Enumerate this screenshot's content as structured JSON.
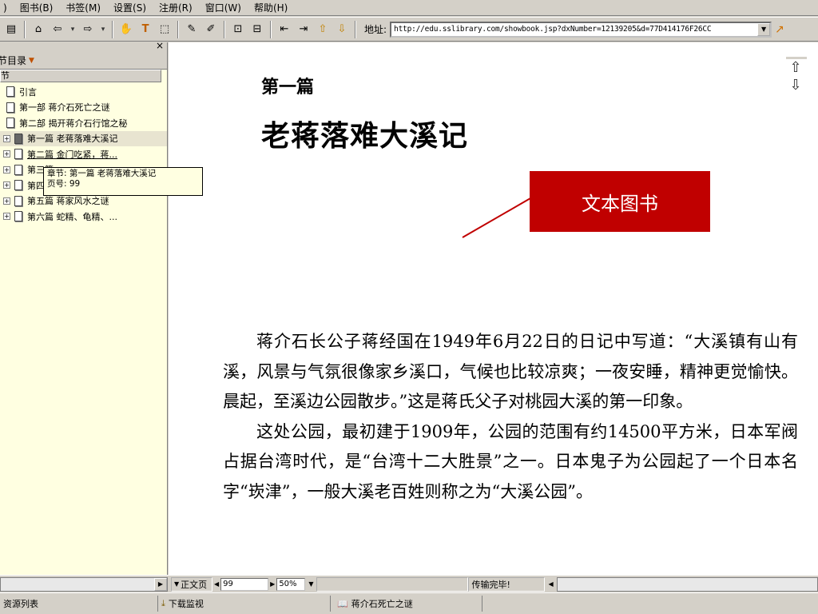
{
  "menubar": {
    "items": [
      ")",
      "图书(B)",
      "书签(M)",
      "设置(S)",
      "注册(R)",
      "窗口(W)",
      "帮助(H)"
    ]
  },
  "toolbar": {
    "address_label": "地址:",
    "address_value": "http://edu.sslibrary.com/showbook.jsp?dxNumber=12139205&d=77D414176F26CC"
  },
  "sidebar": {
    "close": "×",
    "title": "节目录",
    "column_header": "节",
    "items": [
      {
        "label": "引言",
        "expand": ""
      },
      {
        "label": "第一部 蒋介石死亡之谜",
        "expand": ""
      },
      {
        "label": "第二部 揭开蒋介石行馆之秘",
        "expand": ""
      },
      {
        "label": "第一篇 老蒋落难大溪记",
        "expand": "+"
      },
      {
        "label": "第二篇 金门吃紧，蒋...",
        "expand": "+"
      },
      {
        "label": "第三篇 ...",
        "expand": "+"
      },
      {
        "label": "第四篇 ...",
        "expand": "+"
      },
      {
        "label": "第五篇 蒋家风水之谜",
        "expand": "+"
      },
      {
        "label": "第六篇 蛇精、龟精、...",
        "expand": "+"
      }
    ],
    "tooltip": {
      "line1": "章节: 第一篇  老蒋落难大溪记",
      "line2": "页号: 99"
    }
  },
  "content": {
    "part_label": "第一篇",
    "chapter_title": "老蒋落难大溪记",
    "stamp": "文本图书",
    "paragraphs": [
      "蒋介石长公子蒋经国在1949年6月22日的日记中写道：“大溪镇有山有溪，风景与气氛很像家乡溪口，气候也比较凉爽；一夜安睡，精神更觉愉快。晨起，至溪边公园散步。”这是蒋氏父子对桃园大溪的第一印象。",
      "这处公园，最初建于1909年，公园的范围有约14500平方米，日本军阀占据台湾时代，是“台湾十二大胜景”之一。日本鬼子为公园起了一个日本名字“崁津”，一般大溪老百姓则称之为“大溪公园”。"
    ]
  },
  "statusbar": {
    "view_mode": "正文页",
    "page_number": "99",
    "zoom": "50%",
    "transfer_status": "传输完毕!"
  },
  "taskbar": {
    "tasks": [
      "资源列表",
      "下载监视",
      "蒋介石死亡之谜"
    ]
  }
}
